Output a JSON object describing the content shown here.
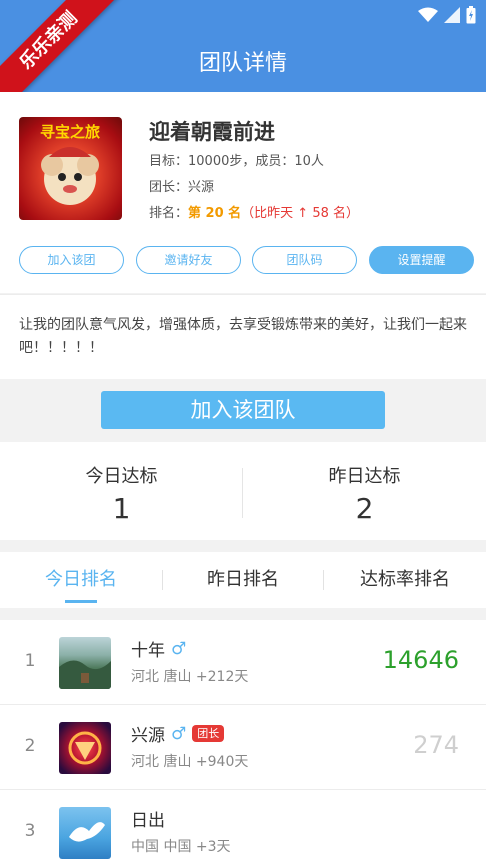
{
  "watermark": "乐乐亲测",
  "header": {
    "title": "团队详情"
  },
  "team": {
    "name": "迎着朝霞前进",
    "goal": "目标：10000步，成员：10人",
    "leader": "团长：兴源",
    "rank_prefix": "排名：",
    "rank_value": "第 20 名",
    "rank_change": "（比昨天 ↑ 58 名）",
    "avatar_text": "寻宝之旅"
  },
  "actions": [
    "加入该团",
    "邀请好友",
    "团队码",
    "设置提醒"
  ],
  "description": "让我的团队意气风发，增强体质，去享受锻炼带来的美好，让我们一起来吧！！！！！",
  "join_button": "加入该团队",
  "stats": {
    "today_label": "今日达标",
    "today_value": "1",
    "yesterday_label": "昨日达标",
    "yesterday_value": "2"
  },
  "tabs": [
    "今日排名",
    "昨日排名",
    "达标率排名"
  ],
  "members": [
    {
      "rank": "1",
      "name": "十年",
      "gender": "♂",
      "badge": "",
      "location": "河北 唐山   +212天",
      "steps": "14646"
    },
    {
      "rank": "2",
      "name": "兴源",
      "gender": "♂",
      "badge": "团长",
      "location": "河北 唐山   +940天",
      "steps": "274"
    },
    {
      "rank": "3",
      "name": "日出",
      "gender": "",
      "badge": "",
      "location": "中国 中国   +3天",
      "steps": ""
    }
  ],
  "colors": {
    "header": "#4a90e2",
    "accent": "#5ab4f0",
    "steps_top": "#2ca02c",
    "badge": "#e53935"
  }
}
